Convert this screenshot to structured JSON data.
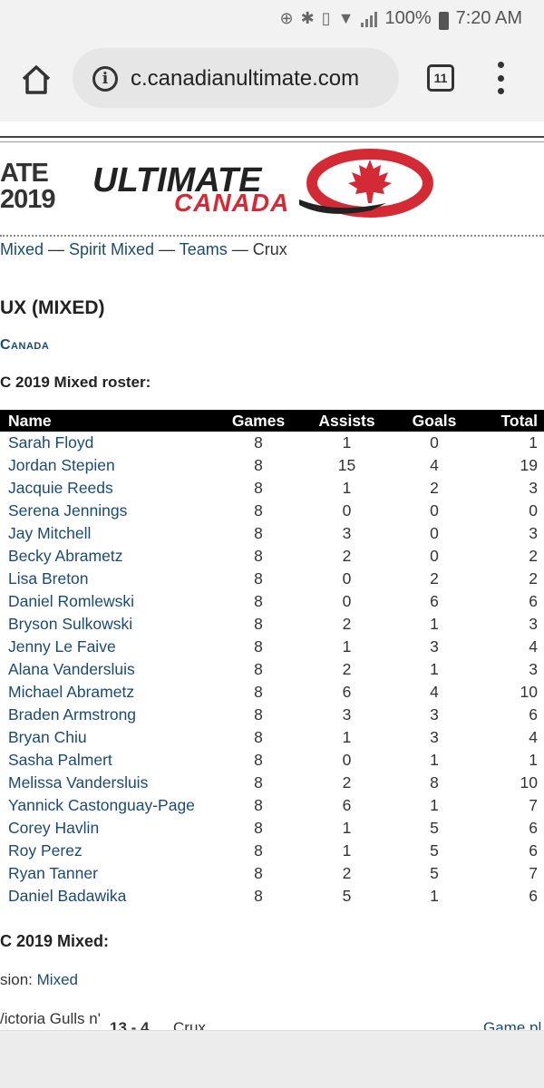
{
  "status_bar": {
    "battery_text": "100%",
    "time": "7:20 AM"
  },
  "browser": {
    "url": "c.canadianultimate.com",
    "tab_count": "11"
  },
  "banner": {
    "left_line1": "ATE",
    "left_line2": "2019",
    "logo_word": "ULTIMATE",
    "logo_sub": "CANADA"
  },
  "breadcrumb": {
    "item1": "Mixed",
    "sep": " — ",
    "item2": "Spirit Mixed",
    "item3": "Teams",
    "current": "Crux"
  },
  "team_title": "UX (MIXED)",
  "country_link": "Canada",
  "roster_heading": "C 2019 Mixed roster:",
  "roster": {
    "headers": [
      "Name",
      "Games",
      "Assists",
      "Goals",
      "Total"
    ],
    "rows": [
      [
        "Sarah Floyd",
        "8",
        "1",
        "0",
        "1"
      ],
      [
        "Jordan Stepien",
        "8",
        "15",
        "4",
        "19"
      ],
      [
        "Jacquie Reeds",
        "8",
        "1",
        "2",
        "3"
      ],
      [
        "Serena Jennings",
        "8",
        "0",
        "0",
        "0"
      ],
      [
        "Jay Mitchell",
        "8",
        "3",
        "0",
        "3"
      ],
      [
        "Becky Abrametz",
        "8",
        "2",
        "0",
        "2"
      ],
      [
        "Lisa Breton",
        "8",
        "0",
        "2",
        "2"
      ],
      [
        "Daniel Romlewski",
        "8",
        "0",
        "6",
        "6"
      ],
      [
        "Bryson Sulkowski",
        "8",
        "2",
        "1",
        "3"
      ],
      [
        "Jenny Le Faive",
        "8",
        "1",
        "3",
        "4"
      ],
      [
        "Alana Vandersluis",
        "8",
        "2",
        "1",
        "3"
      ],
      [
        "Michael Abrametz",
        "8",
        "6",
        "4",
        "10"
      ],
      [
        "Braden Armstrong",
        "8",
        "3",
        "3",
        "6"
      ],
      [
        "Bryan Chiu",
        "8",
        "1",
        "3",
        "4"
      ],
      [
        "Sasha Palmert",
        "8",
        "0",
        "1",
        "1"
      ],
      [
        "Melissa Vandersluis",
        "8",
        "2",
        "8",
        "10"
      ],
      [
        "Yannick Castonguay-Page",
        "8",
        "6",
        "1",
        "7"
      ],
      [
        "Corey Havlin",
        "8",
        "1",
        "5",
        "6"
      ],
      [
        "Roy Perez",
        "8",
        "1",
        "5",
        "6"
      ],
      [
        "Ryan Tanner",
        "8",
        "2",
        "5",
        "7"
      ],
      [
        "Daniel Badawika",
        "8",
        "5",
        "1",
        "6"
      ]
    ]
  },
  "games_heading": "C 2019 Mixed:",
  "division": {
    "label": "sion: ",
    "value": "Mixed"
  },
  "game": {
    "team": "/ictoria Gulls n'",
    "score": "13  -  4",
    "opponent": "Crux",
    "link": "Game pl"
  }
}
